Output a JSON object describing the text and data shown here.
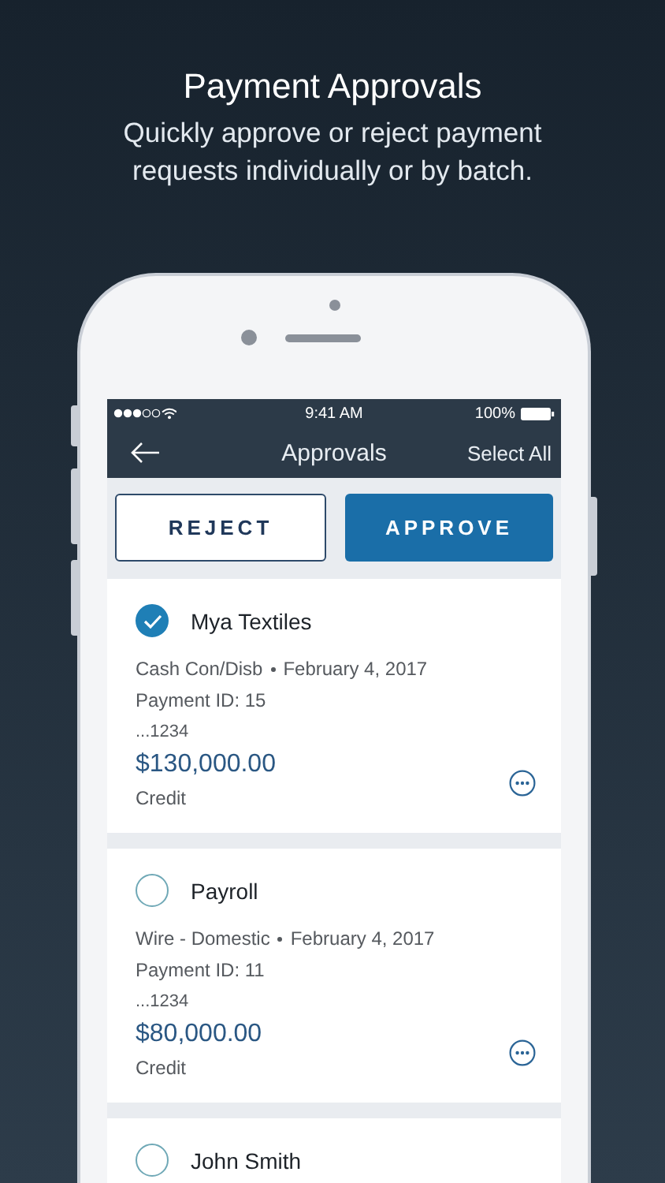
{
  "header": {
    "title": "Payment Approvals",
    "subtitle_lines": [
      "Quickly approve or reject payment",
      "requests individually or by batch."
    ]
  },
  "status_bar": {
    "time": "9:41 AM",
    "battery": "100%"
  },
  "nav": {
    "title": "Approvals",
    "action": "Select All"
  },
  "buttons": [
    {
      "label": "REJECT",
      "kind": "outline"
    },
    {
      "label": "APPROVE",
      "kind": "primary"
    }
  ],
  "payments": [
    {
      "name": "Mya Textiles",
      "selected": true,
      "type": "Cash Con/Disb",
      "date": "February 4, 2017",
      "payment_id": "Payment ID: 15",
      "account": "...1234",
      "amount": "$130,000.00",
      "direction": "Credit"
    },
    {
      "name": "Payroll",
      "selected": false,
      "type": "Wire - Domestic",
      "date": "February 4, 2017",
      "payment_id": "Payment ID: 11",
      "account": "...1234",
      "amount": "$80,000.00",
      "direction": "Credit"
    },
    {
      "name": "John Smith",
      "selected": false
    }
  ]
}
